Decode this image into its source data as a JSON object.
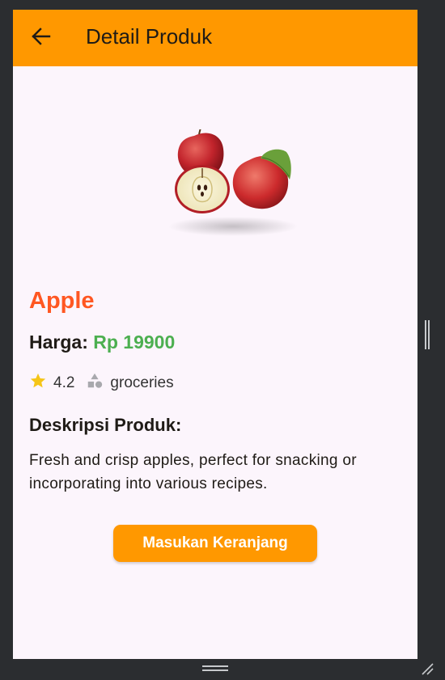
{
  "appbar": {
    "title": "Detail Produk",
    "back_icon": "arrow-left-icon",
    "background": "#ff9800"
  },
  "product": {
    "image_icon": "apple-product-image",
    "name": "Apple",
    "price_label": "Harga: ",
    "price_value": "Rp 19900",
    "rating": "4.2",
    "rating_icon": "star-icon",
    "category": "groceries",
    "category_icon": "category-shapes-icon",
    "description_title": "Deskripsi Produk:",
    "description": "Fresh and crisp apples, perfect for snacking or incorporating into various recipes.",
    "colors": {
      "name": "#ff5722",
      "price": "#4caf50",
      "star": "#f5c518"
    }
  },
  "actions": {
    "add_to_cart_label": "Masukan Keranjang"
  }
}
